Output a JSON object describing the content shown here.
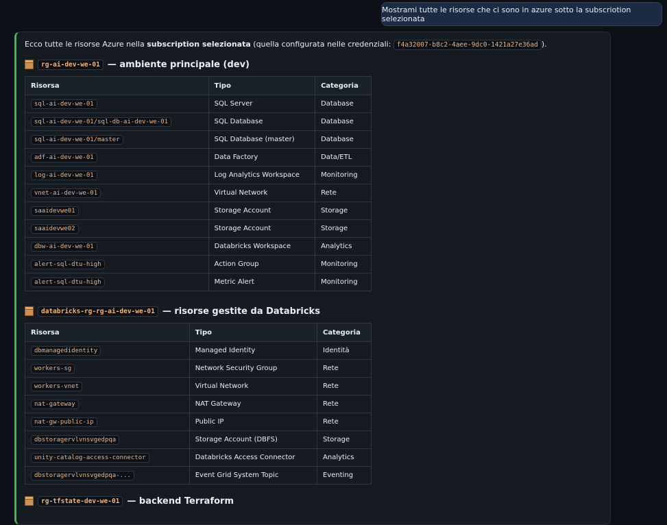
{
  "user_message": "Mostrami tutte le risorse che ci sono in azure sotto  la subscriotion selezionata",
  "intro": {
    "prefix": "Ecco tutte le risorse Azure nella ",
    "bold": "subscription selezionata",
    "middle": " (quella configurata nelle credenziali: ",
    "subscription_id": "f4a32007-b8c2-4aee-9dc0-1421a27e36ad",
    "suffix": ")."
  },
  "sections": [
    {
      "icon": "package-icon",
      "rg": "rg-ai-dev-we-01",
      "title": "— ambiente principale (dev)",
      "headers": [
        "Risorsa",
        "Tipo",
        "Categoria"
      ],
      "rows": [
        [
          "sql-ai-dev-we-01",
          "SQL Server",
          "Database"
        ],
        [
          "sql-ai-dev-we-01/sql-db-ai-dev-we-01",
          "SQL Database",
          "Database"
        ],
        [
          "sql-ai-dev-we-01/master",
          "SQL Database (master)",
          "Database"
        ],
        [
          "adf-ai-dev-we-01",
          "Data Factory",
          "Data/ETL"
        ],
        [
          "log-ai-dev-we-01",
          "Log Analytics Workspace",
          "Monitoring"
        ],
        [
          "vnet-ai-dev-we-01",
          "Virtual Network",
          "Rete"
        ],
        [
          "saaidevwe01",
          "Storage Account",
          "Storage"
        ],
        [
          "saaidevwe02",
          "Storage Account",
          "Storage"
        ],
        [
          "dbw-ai-dev-we-01",
          "Databricks Workspace",
          "Analytics"
        ],
        [
          "alert-sql-dtu-high",
          "Action Group",
          "Monitoring"
        ],
        [
          "alert-sql-dtu-high",
          "Metric Alert",
          "Monitoring"
        ]
      ]
    },
    {
      "icon": "package-icon",
      "rg": "databricks-rg-rg-ai-dev-we-01",
      "title": "— risorse gestite da Databricks",
      "headers": [
        "Risorsa",
        "Tipo",
        "Categoria"
      ],
      "rows": [
        [
          "dbmanagedidentity",
          "Managed Identity",
          "Identità"
        ],
        [
          "workers-sg",
          "Network Security Group",
          "Rete"
        ],
        [
          "workers-vnet",
          "Virtual Network",
          "Rete"
        ],
        [
          "nat-gateway",
          "NAT Gateway",
          "Rete"
        ],
        [
          "nat-gw-public-ip",
          "Public IP",
          "Rete"
        ],
        [
          "dbstoragervlvnsvgedpqa",
          "Storage Account (DBFS)",
          "Storage"
        ],
        [
          "unity-catalog-access-connector",
          "Databricks Access Connector",
          "Analytics"
        ],
        [
          "dbstoragervlvnsvgedpqa-...",
          "Event Grid System Topic",
          "Eventing"
        ]
      ]
    },
    {
      "icon": "package-icon",
      "rg": "rg-tfstate-dev-we-01",
      "title": "— backend Terraform"
    }
  ]
}
